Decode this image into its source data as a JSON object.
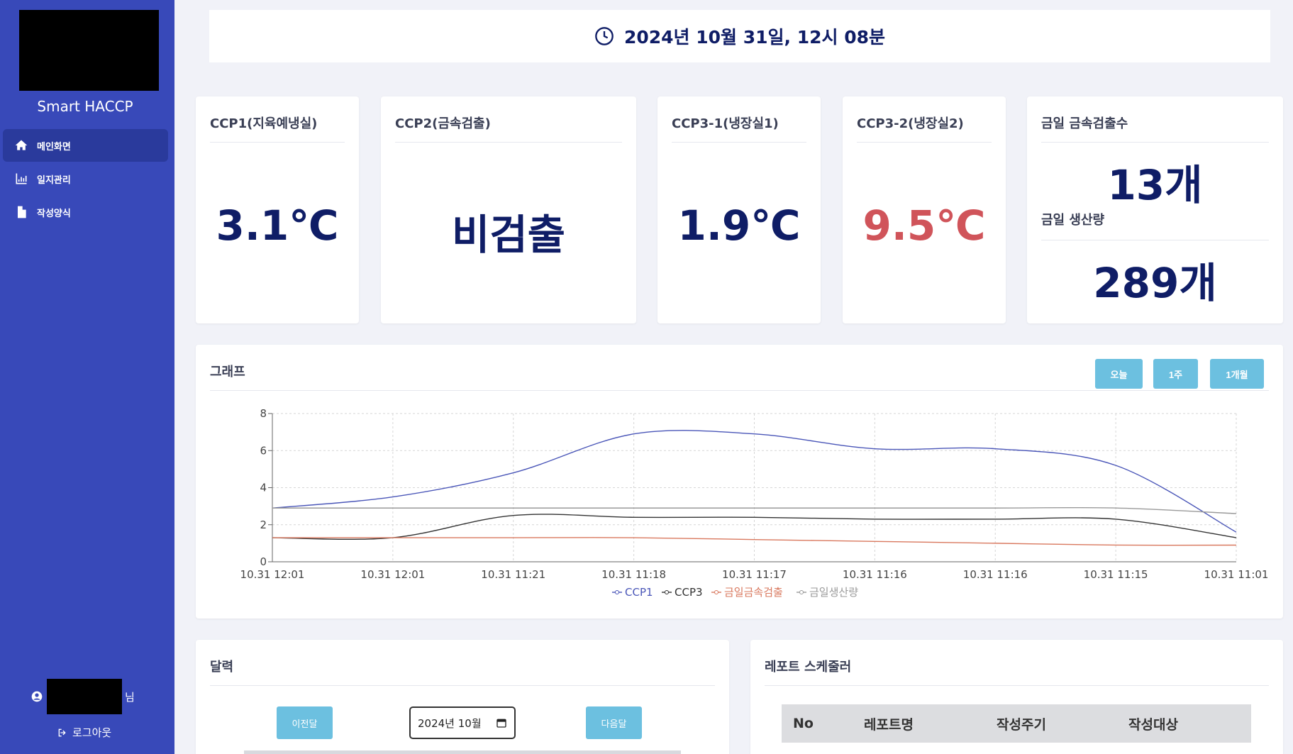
{
  "sidebar": {
    "brand": "Smart HACCP",
    "nav": [
      {
        "label": "메인화면",
        "icon": "home-icon"
      },
      {
        "label": "일지관리",
        "icon": "bar-chart-icon"
      },
      {
        "label": "작성양식",
        "icon": "document-icon"
      }
    ],
    "user_suffix": "님",
    "logout_label": "로그아웃"
  },
  "clock": {
    "text": "2024년 10월 31일, 12시 08분",
    "icon": "clock-icon"
  },
  "cards": {
    "ccp1": {
      "title": "CCP1(지육예냉실)",
      "value": "3.1℃"
    },
    "ccp2": {
      "title": "CCP2(금속검출)",
      "value": "비검출"
    },
    "ccp3_1": {
      "title": "CCP3-1(냉장실1)",
      "value": "1.9℃"
    },
    "ccp3_2": {
      "title": "CCP3-2(냉장실2)",
      "value": "9.5℃"
    },
    "stats": {
      "metal_title": "금일 금속검출수",
      "metal_value": "13개",
      "prod_title": "금일 생산량",
      "prod_value": "289개"
    }
  },
  "colors": {
    "alert": "#d0545a",
    "primary": "#0f1d66",
    "sidebar": "#3849b9",
    "button": "#6cc0e0"
  },
  "graph": {
    "title": "그래프",
    "buttons": {
      "today": "오늘",
      "week": "1주",
      "month": "1개월"
    }
  },
  "chart_data": {
    "type": "line",
    "categories": [
      "10.31 12:01",
      "10.31 12:01",
      "10.31 11:21",
      "10.31 11:18",
      "10.31 11:17",
      "10.31 11:16",
      "10.31 11:16",
      "10.31 11:15",
      "10.31 11:01"
    ],
    "series": [
      {
        "name": "CCP1",
        "color": "#4a56b8",
        "values": [
          2.9,
          3.5,
          4.8,
          6.9,
          6.9,
          6.1,
          6.1,
          5.2,
          1.6
        ]
      },
      {
        "name": "CCP3",
        "color": "#333333",
        "values": [
          1.3,
          1.3,
          2.5,
          2.4,
          2.4,
          2.3,
          2.3,
          2.3,
          1.3
        ]
      },
      {
        "name": "금일금속검출",
        "color": "#d9785e",
        "values": [
          1.3,
          1.3,
          1.3,
          1.3,
          1.2,
          1.1,
          1.0,
          0.9,
          0.9
        ]
      },
      {
        "name": "금일생산량",
        "color": "#9a9a9a",
        "values": [
          2.9,
          2.9,
          2.9,
          2.9,
          2.9,
          2.9,
          2.9,
          2.9,
          2.6
        ]
      }
    ],
    "yticks": [
      "0",
      "2",
      "4",
      "6",
      "8"
    ],
    "ylim": [
      0,
      8
    ],
    "grid": true,
    "legend_position": "bottom"
  },
  "calendar": {
    "title": "달력",
    "prev": "이전달",
    "next": "다음달",
    "month": "2024년 10월"
  },
  "report": {
    "title": "레포트 스케줄러",
    "columns": [
      "No",
      "레포트명",
      "작성주기",
      "작성대상"
    ]
  }
}
